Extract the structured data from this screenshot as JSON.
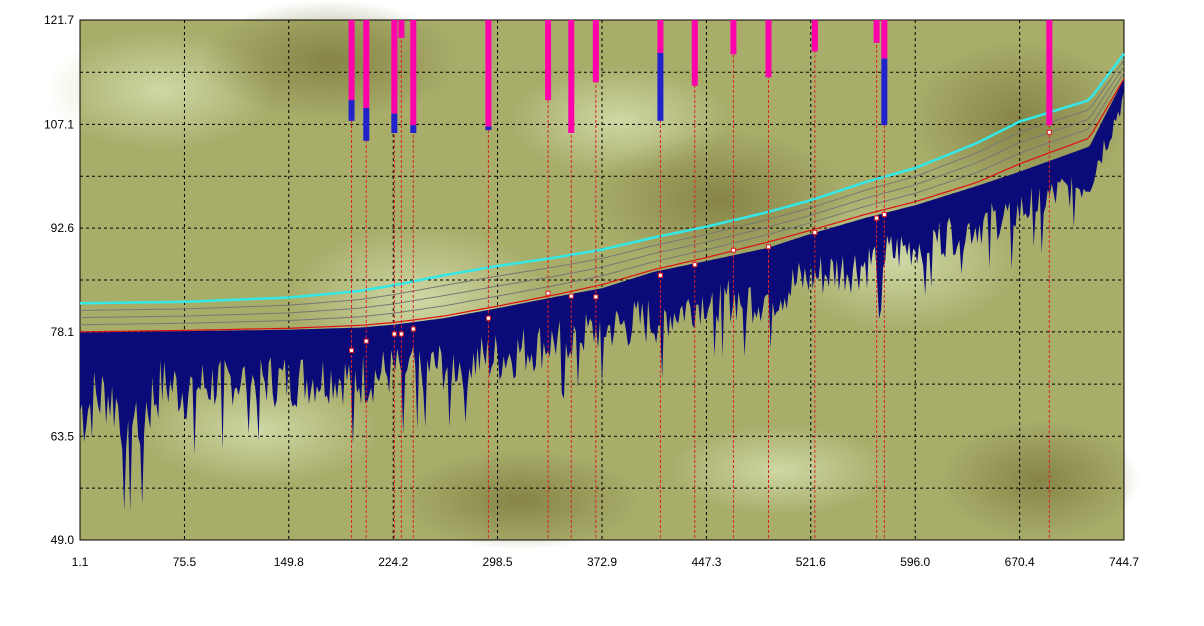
{
  "chart_data": {
    "type": "area",
    "xlim": [
      1.1,
      744.7
    ],
    "ylim": [
      49.0,
      121.7
    ],
    "x_ticks": [
      "1.1",
      "75.5",
      "149.8",
      "224.2",
      "298.5",
      "372.9",
      "447.3",
      "521.6",
      "596.0",
      "670.4",
      "744.7"
    ],
    "y_ticks": [
      "49.0",
      "63.5",
      "78.1",
      "92.6",
      "107.1",
      "121.7"
    ],
    "grid": true,
    "colors": {
      "terrain_fill": "#0a0a78",
      "upper_line": "#33e8e8",
      "lower_line": "#dd1111",
      "guide_lines": "#777777",
      "event_bar": "#ff00aa",
      "event_bar_inner": "#2222cc",
      "event_marker": "#dd2222",
      "background": "#a8ad6a"
    },
    "series": [
      {
        "values_kind": "upper",
        "x": [
          1.1,
          75.5,
          149.8,
          200,
          224.2,
          260,
          298.5,
          340,
          372.9,
          410,
          447.3,
          490,
          521.6,
          560,
          596.0,
          640,
          670.4,
          720,
          744.7
        ],
        "y": [
          82.1,
          82.3,
          82.9,
          83.8,
          84.6,
          86.0,
          87.3,
          88.5,
          89.6,
          91.3,
          92.8,
          94.8,
          96.5,
          99.0,
          101.0,
          104.5,
          107.5,
          110.5,
          117.0
        ]
      },
      {
        "values_kind": "lower",
        "x": [
          1.1,
          75.5,
          149.8,
          200,
          224.2,
          260,
          298.5,
          340,
          372.9,
          410,
          447.3,
          490,
          521.6,
          560,
          596.0,
          640,
          670.4,
          720,
          744.7
        ],
        "y": [
          78.1,
          78.3,
          78.6,
          79.0,
          79.4,
          80.3,
          81.7,
          83.3,
          84.7,
          86.8,
          88.5,
          90.6,
          92.3,
          94.5,
          96.3,
          99.0,
          101.6,
          105.2,
          113.5
        ]
      },
      {
        "values_kind": "terrain_top",
        "x": [
          1.1,
          75.5,
          149.8,
          200,
          224.2,
          260,
          298.5,
          340,
          372.9,
          410,
          447.3,
          490,
          521.6,
          560,
          596.0,
          640,
          670.4,
          720,
          744.7
        ],
        "y": [
          78.0,
          78.2,
          78.4,
          78.7,
          79.1,
          80.0,
          81.4,
          83.0,
          84.2,
          86.5,
          88.0,
          89.8,
          91.8,
          94.0,
          95.8,
          98.5,
          100.5,
          104.0,
          113.5
        ]
      },
      {
        "values_kind": "terrain_bottom",
        "x": [
          1.1,
          20,
          40,
          60,
          75.5,
          110,
          149.8,
          180,
          200,
          224.2,
          260,
          298.5,
          340,
          372.9,
          410,
          447.3,
          490,
          521.6,
          560,
          596.0,
          640,
          670.4,
          720,
          744.7
        ],
        "y": [
          55.0,
          60.0,
          52.0,
          62.5,
          61.0,
          64.0,
          63.5,
          64.5,
          63.5,
          65.5,
          66.0,
          67.0,
          70.0,
          72.0,
          72.5,
          76.5,
          75.5,
          79.0,
          80.5,
          84.0,
          87.0,
          89.0,
          94.0,
          108.0
        ]
      }
    ],
    "event_markers": {
      "x": [
        194.5,
        205.0,
        225.0,
        230.0,
        238.5,
        292.0,
        334.5,
        351.0,
        368.5,
        414.5,
        439.0,
        466.5,
        491.5,
        524.5,
        568.5,
        574.0,
        691.5
      ],
      "bar_bottom_y": [
        107.6,
        104.8,
        105.9,
        119.2,
        105.9,
        106.3,
        110.5,
        105.9,
        113.0,
        107.6,
        112.5,
        116.9,
        113.7,
        117.3,
        118.5,
        107.0,
        107.0
      ],
      "bar_mid_y": [
        110.5,
        109.4,
        108.6,
        119.2,
        107.0,
        106.8,
        110.5,
        105.9,
        113.0,
        117.1,
        112.5,
        116.9,
        113.7,
        117.3,
        118.5,
        116.3,
        107.0
      ],
      "point_y": [
        75.5,
        76.8,
        77.8,
        77.8,
        78.5,
        80.0,
        83.5,
        83.1,
        83.0,
        86.0,
        87.5,
        89.5,
        90.0,
        92.0,
        94.0,
        94.5,
        106.0
      ]
    }
  }
}
